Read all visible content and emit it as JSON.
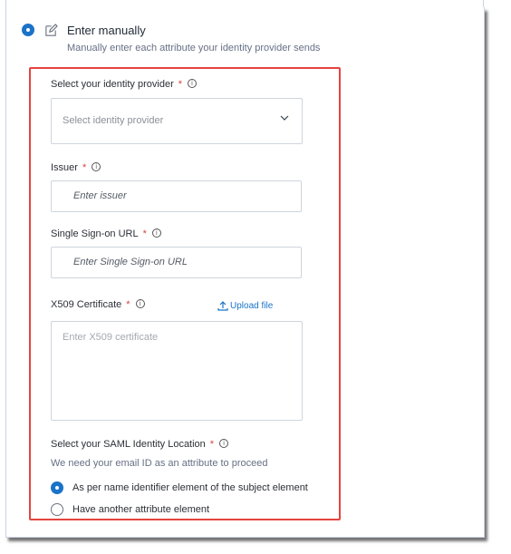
{
  "option": {
    "title": "Enter manually",
    "subtitle": "Manually enter each attribute your identity provider sends",
    "selected": true
  },
  "fields": {
    "identity_provider": {
      "label": "Select your identity provider",
      "required": "*",
      "placeholder": "Select identity provider"
    },
    "issuer": {
      "label": "Issuer",
      "required": "*",
      "placeholder": "Enter issuer"
    },
    "sso_url": {
      "label": "Single Sign-on URL",
      "required": "*",
      "placeholder": "Enter Single Sign-on URL"
    },
    "certificate": {
      "label": "X509 Certificate",
      "required": "*",
      "placeholder": "Enter X509 certificate",
      "upload_label": "Upload file"
    }
  },
  "saml_location": {
    "label": "Select your SAML Identity Location",
    "required": "*",
    "hint": "We need your email ID as an attribute to proceed",
    "options": [
      {
        "label": "As per name identifier element of the subject element",
        "selected": true
      },
      {
        "label": "Have another attribute element",
        "selected": false
      }
    ]
  },
  "colors": {
    "accent": "#1a73c8",
    "required": "#d9433b",
    "highlight_box": "#e4443f"
  },
  "icons": [
    "edit-icon",
    "info-icon",
    "chevron-down-icon",
    "upload-icon"
  ]
}
